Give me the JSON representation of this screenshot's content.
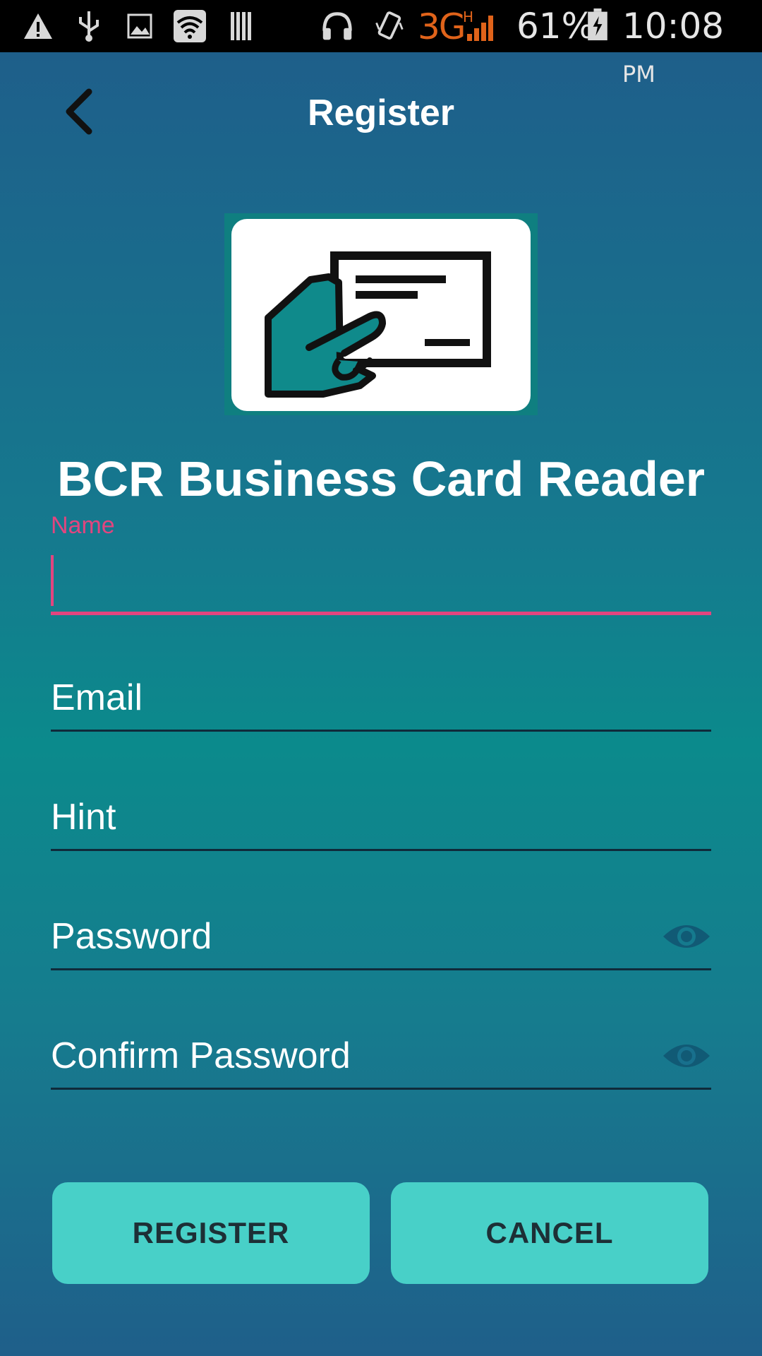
{
  "status_bar": {
    "network": "3G",
    "network_sub": "H",
    "battery": "61%",
    "time": "10:08",
    "time_suffix": "PM"
  },
  "header": {
    "title": "Register"
  },
  "app": {
    "name": "BCR Business Card Reader"
  },
  "form": {
    "name_label": "Name",
    "name_value": "",
    "email_placeholder": "Email",
    "hint_placeholder": "Hint",
    "password_placeholder": "Password",
    "confirm_password_placeholder": "Confirm Password"
  },
  "buttons": {
    "register_label": "REGISTER",
    "cancel_label": "CANCEL"
  },
  "colors": {
    "accent": "#e2457f",
    "button_bg": "#48d0c8",
    "background_top": "#1f5c8a",
    "background_mid": "#0b8a8c"
  },
  "icons": {
    "back": "chevron-left-icon",
    "password_toggle": "eye-icon",
    "logo": "business-card-hand-icon"
  }
}
